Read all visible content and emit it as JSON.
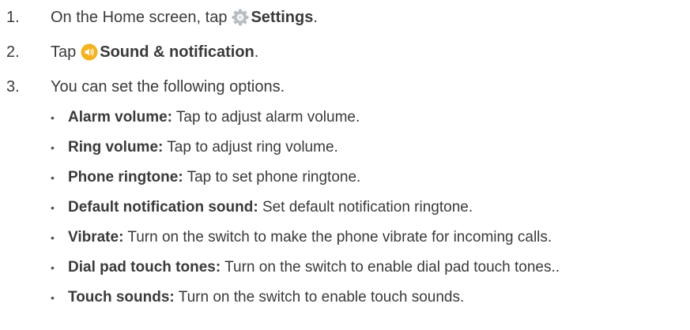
{
  "steps": [
    {
      "number": "1.",
      "before": "On the Home screen, tap",
      "icon": "settings-gear-icon",
      "bold": "Settings",
      "after": "."
    },
    {
      "number": "2.",
      "before": "Tap",
      "icon": "sound-notification-icon",
      "bold": "Sound & notification",
      "after": "."
    },
    {
      "number": "3.",
      "text": "You can set the following options."
    }
  ],
  "options": [
    {
      "term": "Alarm volume:",
      "desc": "Tap to adjust alarm volume."
    },
    {
      "term": "Ring volume:",
      "desc": "Tap to adjust ring volume."
    },
    {
      "term": "Phone ringtone:",
      "desc": "Tap to set phone ringtone."
    },
    {
      "term": "Default notification sound:",
      "desc": "Set default notification ringtone."
    },
    {
      "term": "Vibrate:",
      "desc": "Turn on the switch to make the phone vibrate for incoming calls."
    },
    {
      "term": "Dial pad touch tones:",
      "desc": "Turn on the switch to enable dial pad touch tones.."
    },
    {
      "term": "Touch sounds:",
      "desc": "Turn on the switch to enable touch sounds."
    }
  ],
  "colors": {
    "text": "#3a3a3a",
    "settings_icon": "#b9bec4",
    "sound_icon": "#f5b21b"
  }
}
